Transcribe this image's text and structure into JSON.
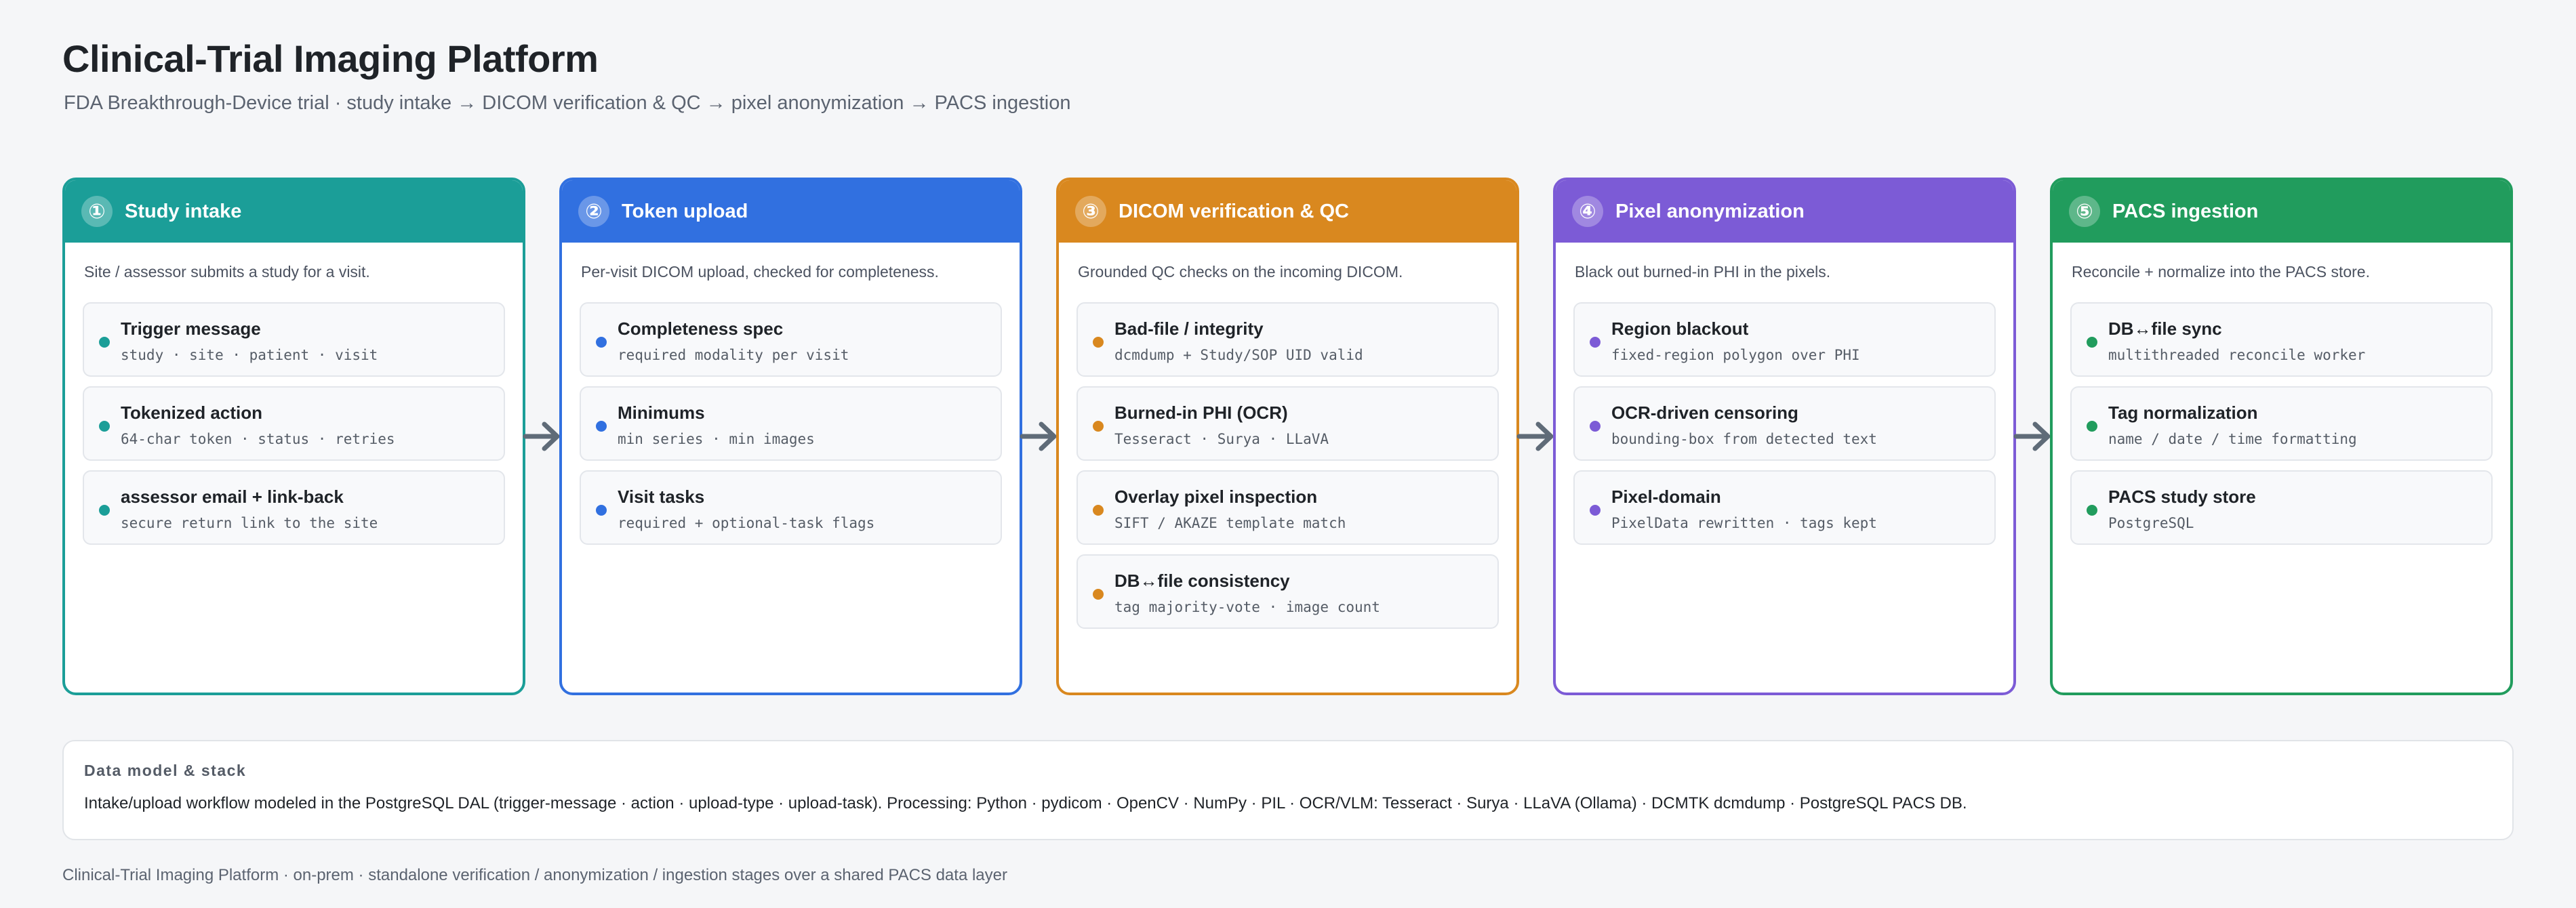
{
  "header": {
    "title": "Clinical-Trial Imaging Platform",
    "subtitle": "FDA Breakthrough-Device trial · study intake → DICOM verification & QC → pixel anonymization → PACS ingestion"
  },
  "colors": {
    "stage1": "#1b9e98",
    "stage2": "#3170e0",
    "stage3": "#d9881f",
    "stage4": "#7c5bd6",
    "stage5": "#219c5d",
    "arrow": "#5f6b78"
  },
  "stages": [
    {
      "num": "①",
      "title": "Study intake",
      "desc": "Site / assessor submits a study for a visit.",
      "items": [
        {
          "title": "Trigger message",
          "sub": "study · site · patient · visit"
        },
        {
          "title": "Tokenized action",
          "sub": "64-char token · status · retries"
        },
        {
          "title": "assessor email + link-back",
          "sub": "secure return link to the site"
        }
      ]
    },
    {
      "num": "②",
      "title": "Token upload",
      "desc": "Per-visit DICOM upload, checked for completeness.",
      "items": [
        {
          "title": "Completeness spec",
          "sub": "required modality per visit"
        },
        {
          "title": "Minimums",
          "sub": "min series · min images"
        },
        {
          "title": "Visit tasks",
          "sub": "required + optional-task flags"
        }
      ]
    },
    {
      "num": "③",
      "title": "DICOM verification & QC",
      "desc": "Grounded QC checks on the incoming DICOM.",
      "items": [
        {
          "title": "Bad-file / integrity",
          "sub": "dcmdump + Study/SOP UID valid"
        },
        {
          "title": "Burned-in PHI (OCR)",
          "sub": "Tesseract · Surya · LLaVA"
        },
        {
          "title": "Overlay pixel inspection",
          "sub": "SIFT / AKAZE template match"
        },
        {
          "title": "DB↔file consistency",
          "sub": "tag majority-vote · image count"
        }
      ]
    },
    {
      "num": "④",
      "title": "Pixel anonymization",
      "desc": "Black out burned-in PHI in the pixels.",
      "items": [
        {
          "title": "Region blackout",
          "sub": "fixed-region polygon over PHI"
        },
        {
          "title": "OCR-driven censoring",
          "sub": "bounding-box from detected text"
        },
        {
          "title": "Pixel-domain",
          "sub": "PixelData rewritten · tags kept"
        }
      ]
    },
    {
      "num": "⑤",
      "title": "PACS ingestion",
      "desc": "Reconcile + normalize into the PACS store.",
      "items": [
        {
          "title": "DB↔file sync",
          "sub": "multithreaded reconcile worker"
        },
        {
          "title": "Tag normalization",
          "sub": "name / date / time formatting"
        },
        {
          "title": "PACS study store",
          "sub": "PostgreSQL"
        }
      ]
    }
  ],
  "notes": {
    "title": "Data model & stack",
    "body": "Intake/upload workflow modeled in the PostgreSQL DAL (trigger-message · action · upload-type · upload-task). Processing: Python · pydicom · OpenCV · NumPy · PIL · OCR/VLM: Tesseract · Surya · LLaVA (Ollama) · DCMTK dcmdump · PostgreSQL PACS DB."
  },
  "footer": {
    "text": "Clinical-Trial Imaging Platform · on-prem · standalone verification / anonymization / ingestion stages over a shared PACS data layer"
  }
}
